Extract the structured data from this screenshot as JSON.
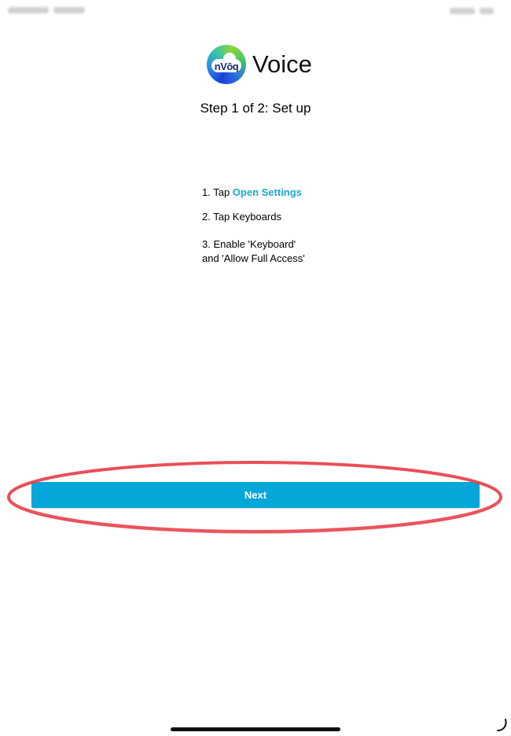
{
  "header": {
    "logo_text": "nVōq",
    "app_name": "Voice"
  },
  "step_title": "Step 1 of 2: Set up",
  "instructions": {
    "item1_prefix": "1. Tap ",
    "item1_link": "Open Settings",
    "item2": "2. Tap Keyboards",
    "item3_line1": "3. Enable 'Keyboard'",
    "item3_line2": "and 'Allow Full Access'"
  },
  "next_button": {
    "label": "Next"
  },
  "colors": {
    "accent": "#06a7d8",
    "link": "#1ba9cf",
    "annotation": "#e8424a"
  },
  "icons": {
    "logo": "nvoq-logo-icon",
    "spinner": "loading-spinner-icon"
  }
}
